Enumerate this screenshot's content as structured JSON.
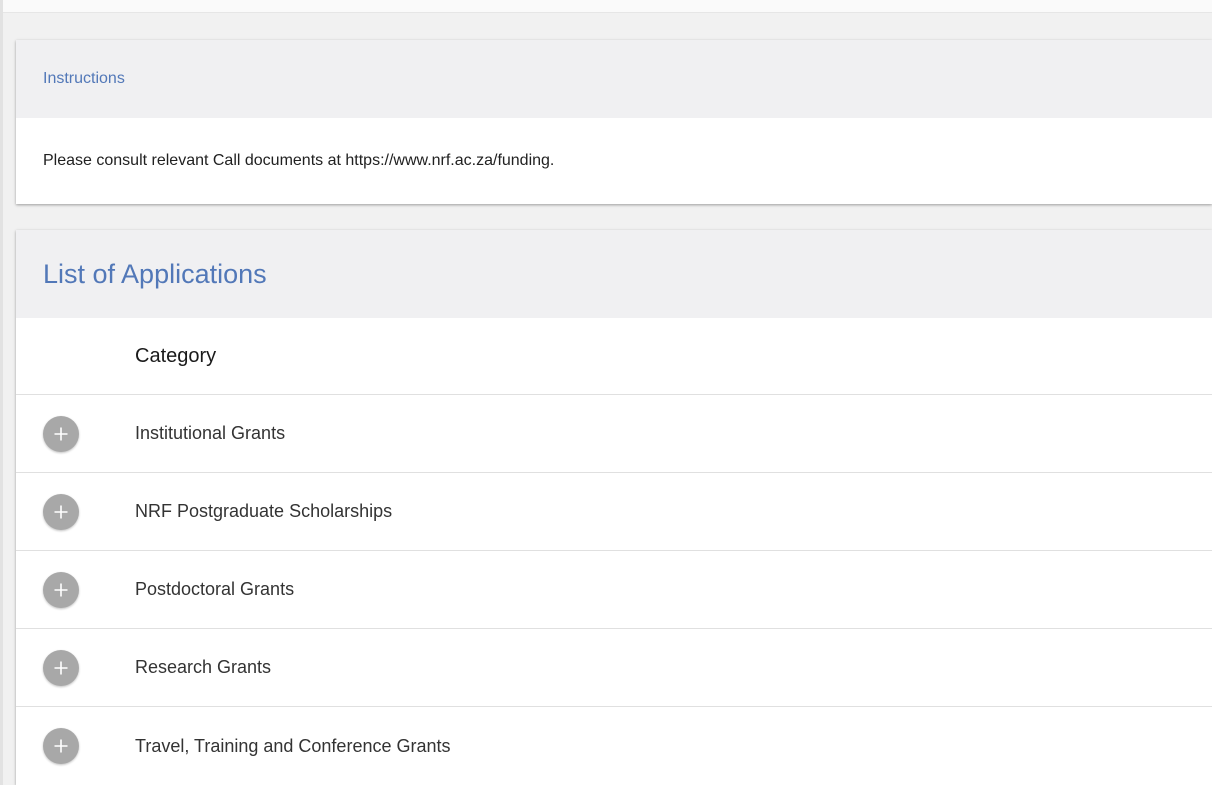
{
  "instructions": {
    "title": "Instructions",
    "body": "Please consult relevant Call documents at https://www.nrf.ac.za/funding."
  },
  "applications": {
    "title": "List of Applications",
    "column_header": "Category",
    "rows": [
      {
        "label": "Institutional Grants",
        "icon": "plus-circle-icon"
      },
      {
        "label": "NRF Postgraduate Scholarships",
        "icon": "plus-circle-icon"
      },
      {
        "label": "Postdoctoral Grants",
        "icon": "plus-circle-icon"
      },
      {
        "label": "Research Grants",
        "icon": "plus-circle-icon"
      },
      {
        "label": "Travel, Training and Conference Grants",
        "icon": "plus-circle-icon"
      }
    ]
  },
  "colors": {
    "accent": "#5278b8",
    "expand_button": "#a8a8a8",
    "header_bg": "#f0f0f2"
  }
}
